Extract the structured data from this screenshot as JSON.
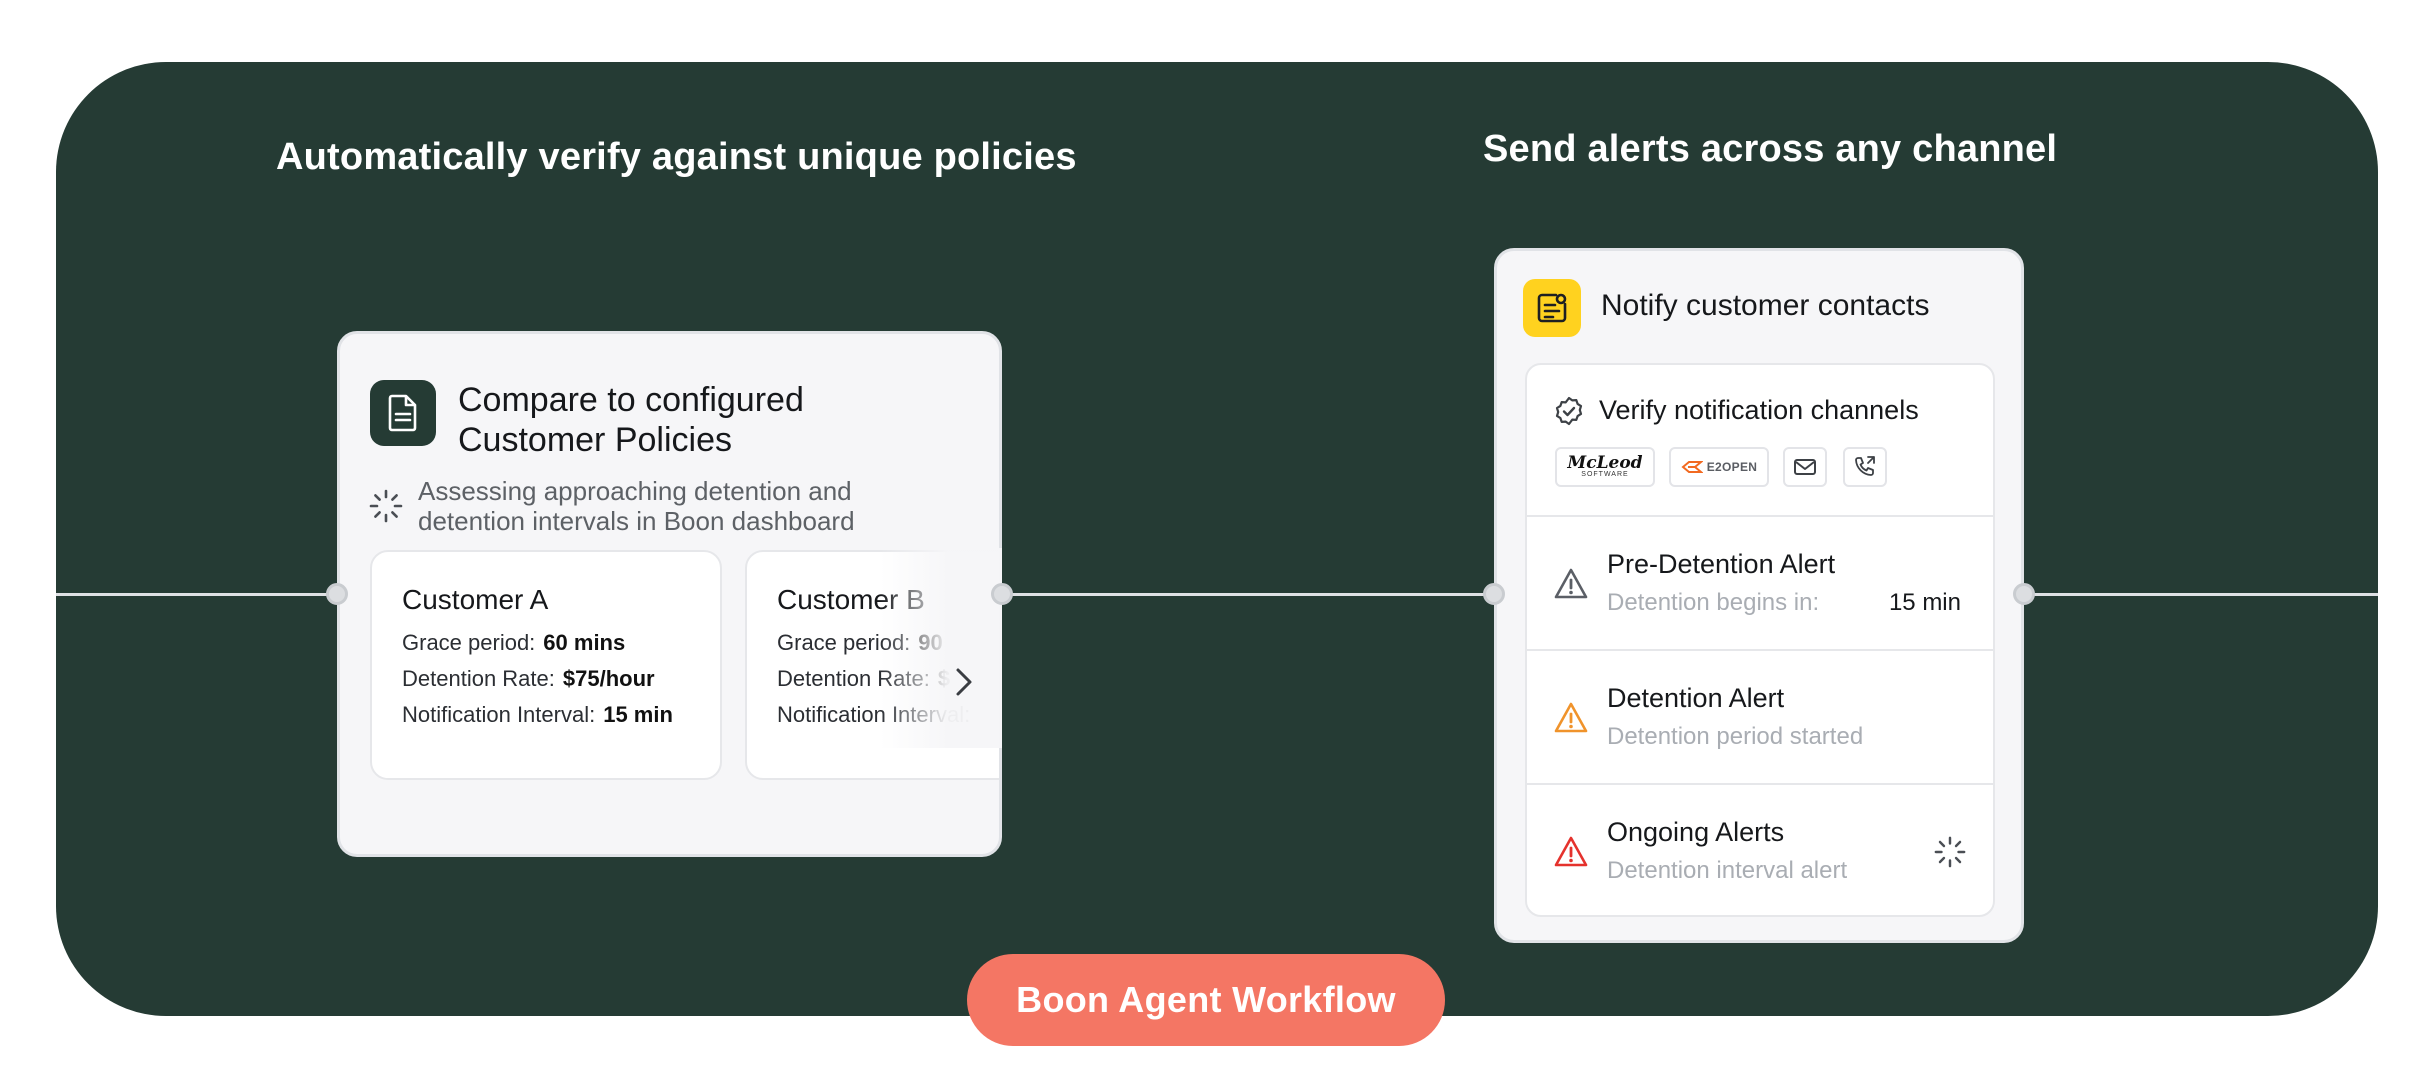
{
  "section_headings": {
    "left": "Automatically verify against unique policies",
    "right": "Send alerts across any channel"
  },
  "policy_card": {
    "title": "Compare to configured Customer Policies",
    "status": "Assessing approaching detention and detention intervals in Boon dashboard",
    "customers": [
      {
        "name": "Customer A",
        "grace_label": "Grace period:",
        "grace_value": "60 mins",
        "rate_label": "Detention Rate:",
        "rate_value": "$75/hour",
        "interval_label": "Notification Interval:",
        "interval_value": "15 min"
      },
      {
        "name": "Customer B",
        "grace_label": "Grace period:",
        "grace_value": "90",
        "rate_label": "Detention Rate:",
        "rate_value": "$",
        "interval_label": "Notification Interval:"
      }
    ]
  },
  "notify_card": {
    "title": "Notify customer contacts",
    "verify": {
      "title": "Verify notification channels",
      "channels": {
        "mcleod": "McLeod",
        "mcleod_sub": "SOFTWARE",
        "e2open": "E2OPEN"
      }
    },
    "alerts": [
      {
        "title": "Pre-Detention Alert",
        "subtitle": "Detention begins in:",
        "value": "15 min",
        "color": "#5b5f66"
      },
      {
        "title": "Detention Alert",
        "subtitle": "Detention period started",
        "value": "",
        "color": "#f0932b"
      },
      {
        "title": "Ongoing Alerts",
        "subtitle": "Detention interval alert",
        "value": "",
        "color": "#e5322d"
      }
    ]
  },
  "workflow_pill": {
    "label": "Boon Agent Workflow"
  },
  "colors": {
    "panel": "#253b34",
    "pill": "#f47664",
    "notify_badge": "#ffd21f"
  },
  "icons": {
    "policy_badge": "document-icon",
    "notify_badge": "notification-doc-icon",
    "status": "spinner-icon",
    "verify": "badge-check-icon",
    "email": "mail-icon",
    "phone": "phone-forward-icon",
    "next": "chevron-right-icon",
    "alert": "warning-triangle-icon"
  }
}
